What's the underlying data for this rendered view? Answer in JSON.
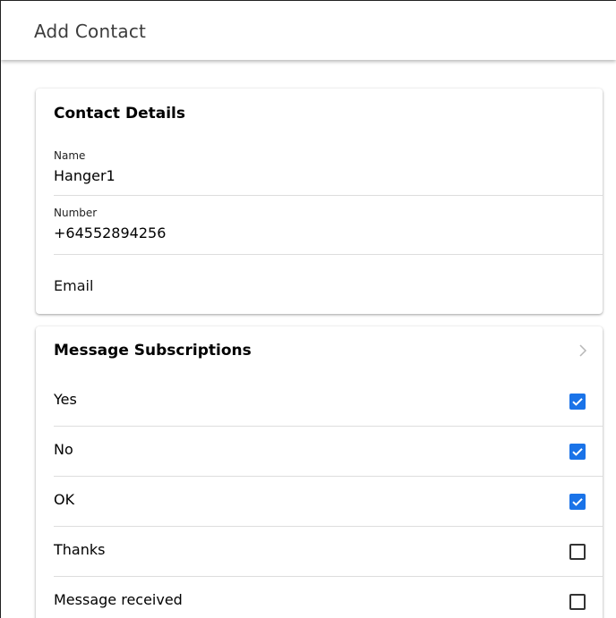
{
  "toolbar": {
    "title": "Add Contact"
  },
  "contact_details": {
    "header": "Contact Details",
    "name": {
      "label": "Name",
      "value": "Hanger1"
    },
    "number": {
      "label": "Number",
      "value": "+64552894256"
    },
    "email": {
      "placeholder": "Email"
    }
  },
  "subscriptions": {
    "header": "Message Subscriptions",
    "chevron_icon": "chevron-right-icon",
    "items": [
      {
        "label": "Yes",
        "checked": true
      },
      {
        "label": "No",
        "checked": true
      },
      {
        "label": "OK",
        "checked": true
      },
      {
        "label": "Thanks",
        "checked": false
      },
      {
        "label": "Message received",
        "checked": false
      }
    ]
  },
  "colors": {
    "accent": "#1a73e8",
    "title_text": "#3c3c3c",
    "divider": "#dddddd"
  }
}
